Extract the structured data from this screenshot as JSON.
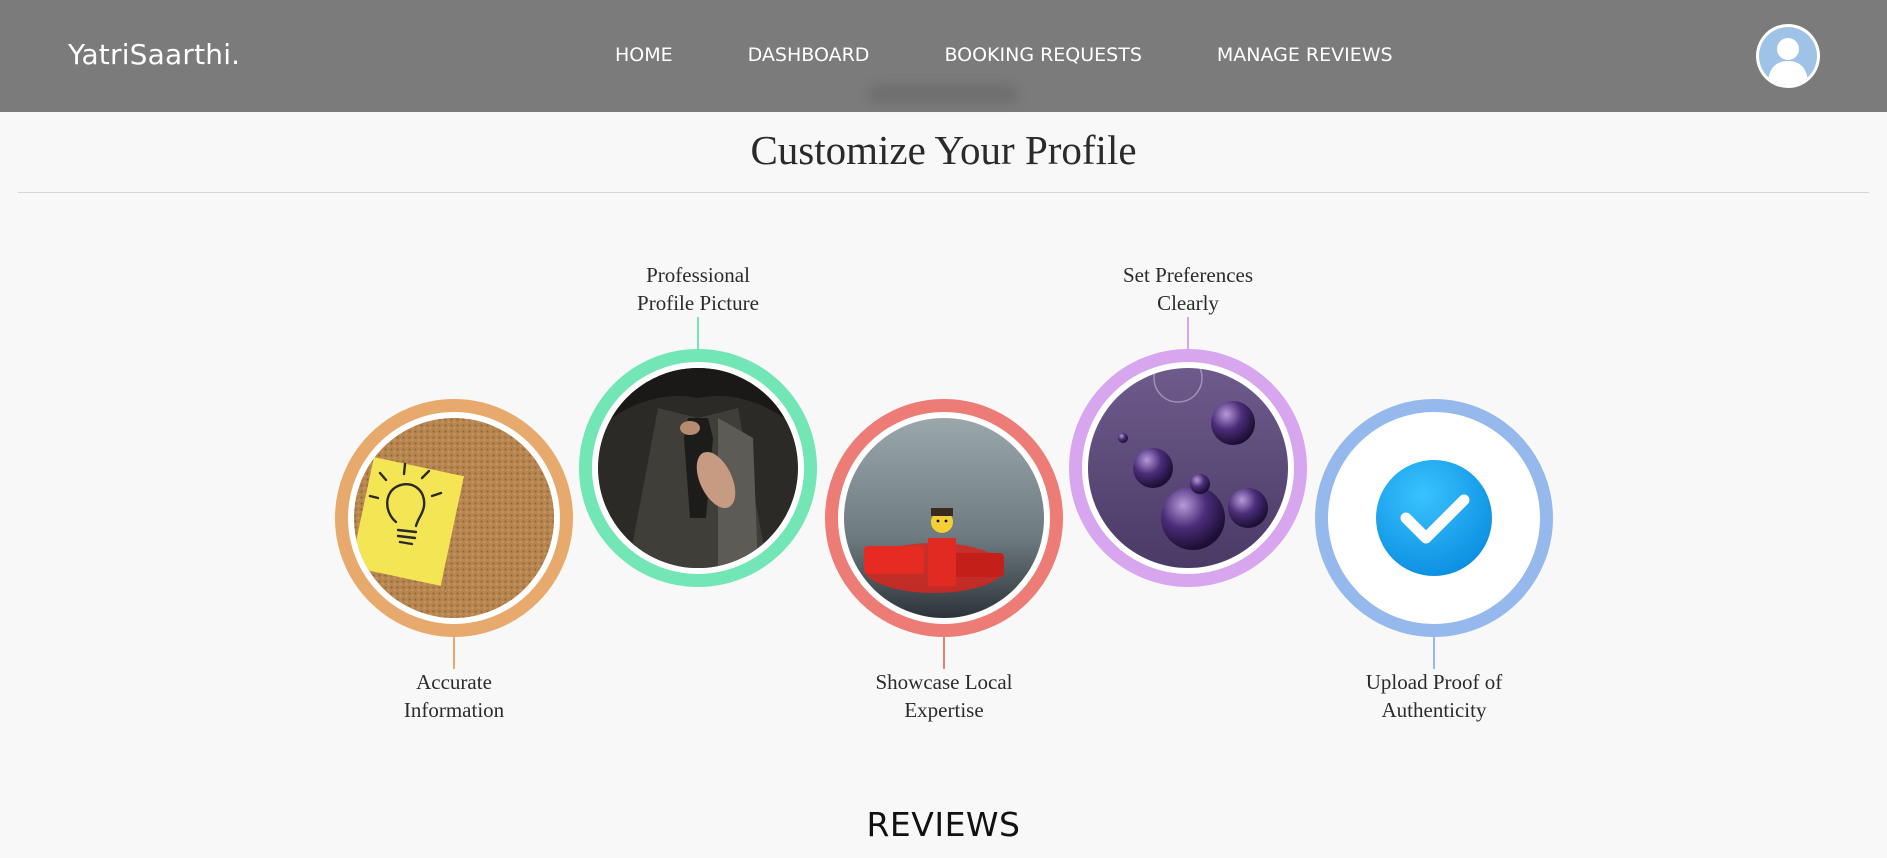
{
  "navbar": {
    "brand": "YatriSaarthi.",
    "links": [
      "HOME",
      "DASHBOARD",
      "BOOKING REQUESTS",
      "MANAGE REVIEWS"
    ],
    "avatar_icon": "user-avatar-icon"
  },
  "profile_section": {
    "title": "Customize Your Profile",
    "steps": [
      {
        "label": "Accurate\nInformation",
        "ring_color": "#e8a96d",
        "image": "sticky-note-lightbulb-on-corkboard"
      },
      {
        "label": "Professional\nProfile Picture",
        "ring_color": "#72e6b4",
        "image": "man-adjusting-necktie"
      },
      {
        "label": "Showcase Local\nExpertise",
        "ring_color": "#ec7c75",
        "image": "lego-figure-on-red-bricks"
      },
      {
        "label": "Set Preferences\nClearly",
        "ring_color": "#d8a6ef",
        "image": "floating-purple-glass-bubbles"
      },
      {
        "label": "Upload Proof of\nAuthenticity",
        "ring_color": "#95b9ec",
        "image": "blue-checkmark-icon"
      }
    ]
  },
  "reviews": {
    "title": "REVIEWS"
  }
}
